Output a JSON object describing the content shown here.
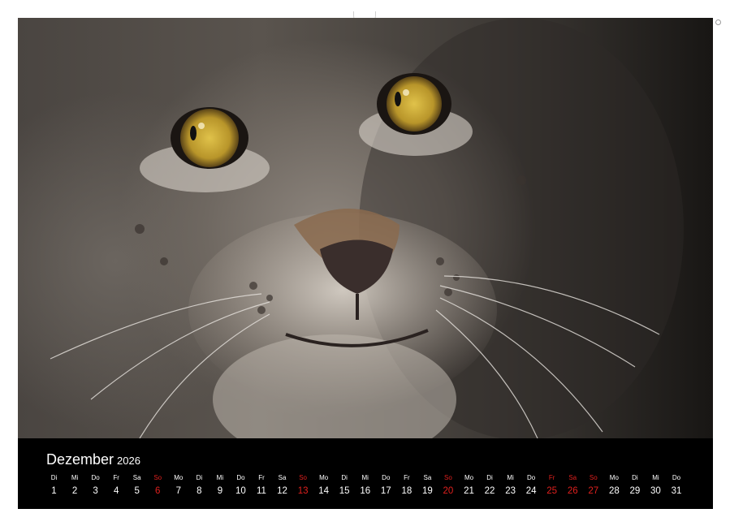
{
  "calendar": {
    "month": "Dezember",
    "year": "2026",
    "days": [
      {
        "wd": "Di",
        "dn": "1",
        "red": false
      },
      {
        "wd": "Mi",
        "dn": "2",
        "red": false
      },
      {
        "wd": "Do",
        "dn": "3",
        "red": false
      },
      {
        "wd": "Fr",
        "dn": "4",
        "red": false
      },
      {
        "wd": "Sa",
        "dn": "5",
        "red": false
      },
      {
        "wd": "So",
        "dn": "6",
        "red": true
      },
      {
        "wd": "Mo",
        "dn": "7",
        "red": false
      },
      {
        "wd": "Di",
        "dn": "8",
        "red": false
      },
      {
        "wd": "Mi",
        "dn": "9",
        "red": false
      },
      {
        "wd": "Do",
        "dn": "10",
        "red": false
      },
      {
        "wd": "Fr",
        "dn": "11",
        "red": false
      },
      {
        "wd": "Sa",
        "dn": "12",
        "red": false
      },
      {
        "wd": "So",
        "dn": "13",
        "red": true
      },
      {
        "wd": "Mo",
        "dn": "14",
        "red": false
      },
      {
        "wd": "Di",
        "dn": "15",
        "red": false
      },
      {
        "wd": "Mi",
        "dn": "16",
        "red": false
      },
      {
        "wd": "Do",
        "dn": "17",
        "red": false
      },
      {
        "wd": "Fr",
        "dn": "18",
        "red": false
      },
      {
        "wd": "Sa",
        "dn": "19",
        "red": false
      },
      {
        "wd": "So",
        "dn": "20",
        "red": true
      },
      {
        "wd": "Mo",
        "dn": "21",
        "red": false
      },
      {
        "wd": "Di",
        "dn": "22",
        "red": false
      },
      {
        "wd": "Mi",
        "dn": "23",
        "red": false
      },
      {
        "wd": "Do",
        "dn": "24",
        "red": false
      },
      {
        "wd": "Fr",
        "dn": "25",
        "red": true
      },
      {
        "wd": "Sa",
        "dn": "26",
        "red": true
      },
      {
        "wd": "So",
        "dn": "27",
        "red": true
      },
      {
        "wd": "Mo",
        "dn": "28",
        "red": false
      },
      {
        "wd": "Di",
        "dn": "29",
        "red": false
      },
      {
        "wd": "Mi",
        "dn": "30",
        "red": false
      },
      {
        "wd": "Do",
        "dn": "31",
        "red": false
      }
    ]
  },
  "photo": {
    "subject": "lynx-face",
    "colors": {
      "eye": "#c9a92a",
      "nose": "#3a2e2c",
      "holiday": "#e0201e"
    }
  }
}
